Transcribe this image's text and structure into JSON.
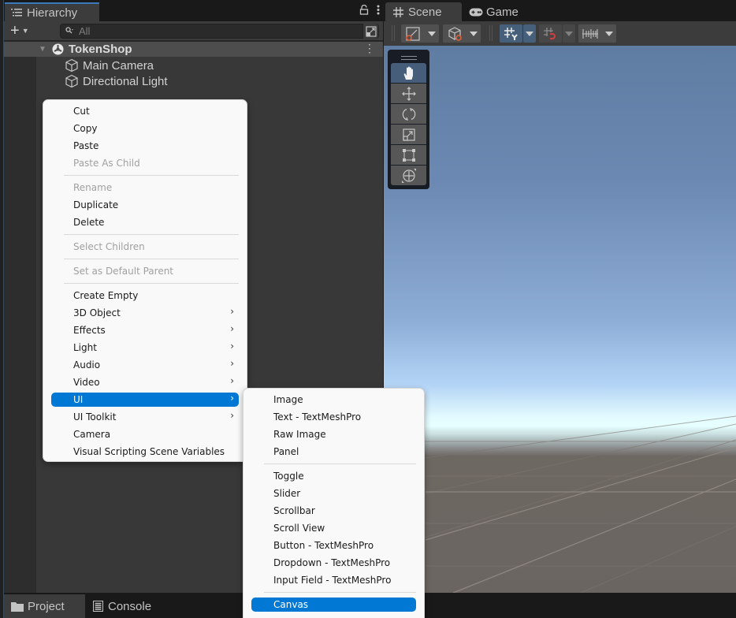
{
  "hierarchy": {
    "tab_label": "Hierarchy",
    "search_placeholder": "All",
    "scene_name": "TokenShop",
    "objects": [
      "Main Camera",
      "Directional Light"
    ]
  },
  "scene_view": {
    "tabs": [
      {
        "label": "Scene",
        "icon": "grid-icon",
        "active": true
      },
      {
        "label": "Game",
        "icon": "gamepad-icon",
        "active": false
      }
    ],
    "toolbar": [
      "draw-mode",
      "shading-mode",
      "grid-snap (active)",
      "increment-snap",
      "ruler"
    ],
    "tools": [
      "hand",
      "move",
      "rotate",
      "scale",
      "rect",
      "transform"
    ],
    "active_tool": "hand"
  },
  "bottom_tabs": [
    "Project",
    "Console"
  ],
  "context_menu": {
    "items": [
      {
        "label": "Cut",
        "enabled": true
      },
      {
        "label": "Copy",
        "enabled": true
      },
      {
        "label": "Paste",
        "enabled": true
      },
      {
        "label": "Paste As Child",
        "enabled": false
      },
      {
        "sep": true
      },
      {
        "label": "Rename",
        "enabled": false
      },
      {
        "label": "Duplicate",
        "enabled": true
      },
      {
        "label": "Delete",
        "enabled": true
      },
      {
        "sep": true
      },
      {
        "label": "Select Children",
        "enabled": false
      },
      {
        "sep": true
      },
      {
        "label": "Set as Default Parent",
        "enabled": false
      },
      {
        "sep": true
      },
      {
        "label": "Create Empty",
        "enabled": true
      },
      {
        "label": "3D Object",
        "enabled": true,
        "submenu": true
      },
      {
        "label": "Effects",
        "enabled": true,
        "submenu": true
      },
      {
        "label": "Light",
        "enabled": true,
        "submenu": true
      },
      {
        "label": "Audio",
        "enabled": true,
        "submenu": true
      },
      {
        "label": "Video",
        "enabled": true,
        "submenu": true
      },
      {
        "label": "UI",
        "enabled": true,
        "submenu": true,
        "selected": true
      },
      {
        "label": "UI Toolkit",
        "enabled": true,
        "submenu": true
      },
      {
        "label": "Camera",
        "enabled": true
      },
      {
        "label": "Visual Scripting Scene Variables",
        "enabled": true
      }
    ]
  },
  "ui_submenu": {
    "items": [
      {
        "label": "Image"
      },
      {
        "label": "Text - TextMeshPro"
      },
      {
        "label": "Raw Image"
      },
      {
        "label": "Panel"
      },
      {
        "sep": true
      },
      {
        "label": "Toggle"
      },
      {
        "label": "Slider"
      },
      {
        "label": "Scrollbar"
      },
      {
        "label": "Scroll View"
      },
      {
        "label": "Button - TextMeshPro"
      },
      {
        "label": "Dropdown - TextMeshPro"
      },
      {
        "label": "Input Field - TextMeshPro"
      },
      {
        "sep": true
      },
      {
        "label": "Canvas",
        "selected": true
      }
    ]
  },
  "colors": {
    "selection_blue": "#0078d4",
    "active_tab_accent": "#3a79bb",
    "active_tool": "#465e7a"
  }
}
